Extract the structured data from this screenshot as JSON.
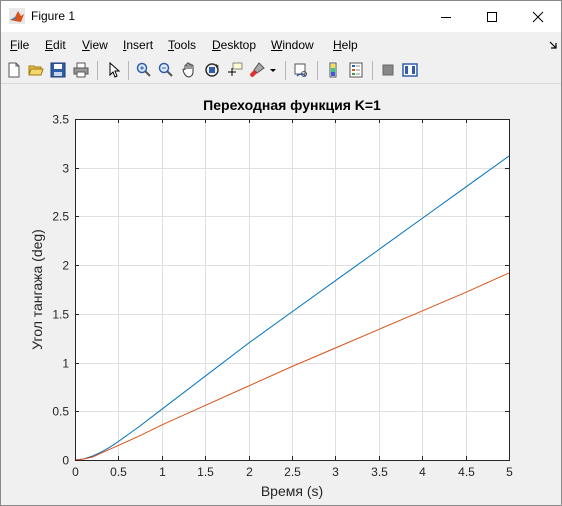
{
  "window": {
    "title": "Figure 1"
  },
  "menu": {
    "items": [
      {
        "label": "File",
        "mnemonic_index": 0
      },
      {
        "label": "Edit",
        "mnemonic_index": 0
      },
      {
        "label": "View",
        "mnemonic_index": 0
      },
      {
        "label": "Insert",
        "mnemonic_index": 0
      },
      {
        "label": "Tools",
        "mnemonic_index": 0
      },
      {
        "label": "Desktop",
        "mnemonic_index": 0
      },
      {
        "label": "Window",
        "mnemonic_index": 0
      },
      {
        "label": "Help",
        "mnemonic_index": 0
      }
    ]
  },
  "toolbar": {
    "icons": [
      "new-figure-icon",
      "open-file-icon",
      "save-icon",
      "print-icon",
      "edit-plot-arrow-icon",
      "zoom-in-icon",
      "zoom-out-icon",
      "pan-hand-icon",
      "rotate-3d-icon",
      "data-cursor-icon",
      "brush-icon",
      "brush-dropdown-icon",
      "link-plot-icon",
      "colorbar-icon",
      "legend-icon",
      "hide-plot-tools-icon",
      "show-plot-tools-icon"
    ]
  },
  "colors": {
    "series1": "#0072bd",
    "series2": "#d95319",
    "grid": "#dfdfdf",
    "axes_bg": "#ffffff"
  },
  "chart_data": {
    "type": "line",
    "title": "Переходная функция K=1",
    "xlabel": "Время (s)",
    "ylabel": "Угол тангажа (deg)",
    "xlim": [
      0,
      5
    ],
    "ylim": [
      0,
      3.5
    ],
    "xticks": [
      "0",
      "0.5",
      "1",
      "1.5",
      "2",
      "2.5",
      "3",
      "3.5",
      "4",
      "4.5",
      "5"
    ],
    "yticks": [
      "0",
      "0.5",
      "1",
      "1.5",
      "2",
      "2.5",
      "3",
      "3.5"
    ],
    "grid": true,
    "series": [
      {
        "color": "#0072bd",
        "x": [
          0,
          0.1,
          0.2,
          0.3,
          0.4,
          0.5,
          0.75,
          1,
          1.5,
          2,
          2.5,
          3,
          3.5,
          4,
          4.5,
          5
        ],
        "y": [
          0,
          0.01,
          0.04,
          0.08,
          0.13,
          0.19,
          0.35,
          0.52,
          0.86,
          1.2,
          1.52,
          1.84,
          2.16,
          2.48,
          2.8,
          3.12
        ]
      },
      {
        "color": "#d95319",
        "x": [
          0,
          0.1,
          0.2,
          0.3,
          0.4,
          0.5,
          0.75,
          1,
          1.5,
          2,
          2.5,
          3,
          3.5,
          4,
          4.5,
          5
        ],
        "y": [
          0,
          0.01,
          0.03,
          0.07,
          0.11,
          0.15,
          0.25,
          0.36,
          0.56,
          0.76,
          0.96,
          1.15,
          1.34,
          1.53,
          1.72,
          1.92
        ]
      }
    ]
  }
}
